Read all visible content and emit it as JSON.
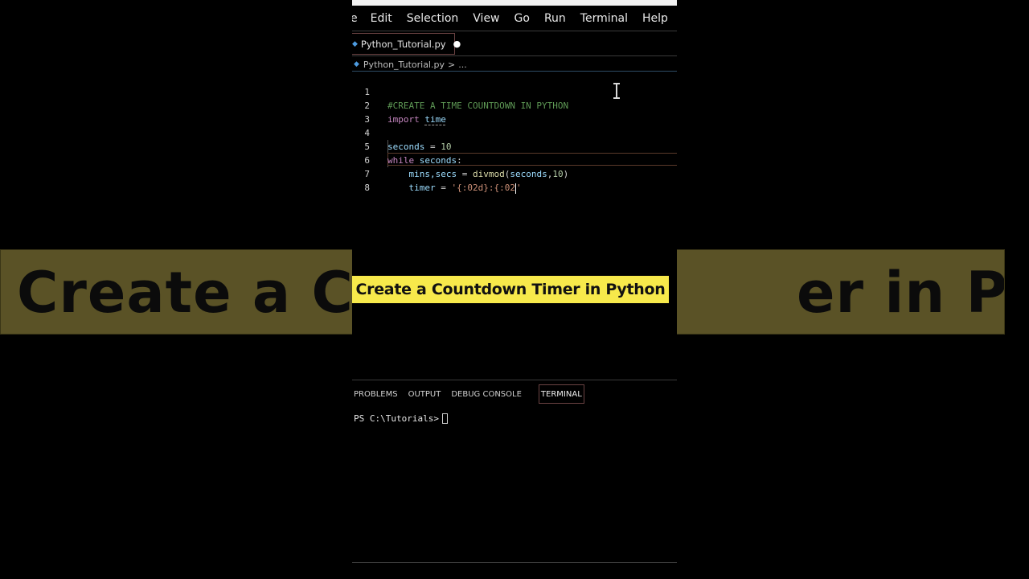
{
  "background": {
    "banner_left_text": "Create a Cou",
    "banner_right_text": "er in Python"
  },
  "menubar": {
    "items": [
      "e",
      "Edit",
      "Selection",
      "View",
      "Go",
      "Run",
      "Terminal",
      "Help"
    ]
  },
  "tab": {
    "filename": "Python_Tutorial.py",
    "modified_dot": "●"
  },
  "breadcrumb": {
    "file": "Python_Tutorial.py",
    "separator": ">",
    "rest": "..."
  },
  "code": {
    "line_numbers": [
      "1",
      "2",
      "3",
      "4",
      "5",
      "6",
      "7",
      "8"
    ],
    "l1": "#CREATE A TIME COUNTDOWN IN PYTHON",
    "l2_kw": "import",
    "l2_mod": "time",
    "l4_var": "seconds",
    "l4_eq": " = ",
    "l4_num": "10",
    "l5_kw": "while",
    "l5_var": "seconds",
    "l5_colon": ":",
    "l6_vars": "mins,secs",
    "l6_eq": " = ",
    "l6_fn": "divmod",
    "l6_open": "(",
    "l6_arg": "seconds",
    "l6_comma": ",",
    "l6_num": "10",
    "l6_close": ")",
    "l7_var": "timer",
    "l7_eq": " = ",
    "l7_str_a": "'{:02d}:{:02",
    "l7_str_b": "'"
  },
  "title": {
    "text": "Create a Countdown Timer in Python"
  },
  "panel": {
    "tabs": [
      "PROBLEMS",
      "OUTPUT",
      "DEBUG CONSOLE",
      "TERMINAL"
    ],
    "active_tab": "TERMINAL",
    "prompt": "PS C:\\Tutorials>"
  },
  "colors": {
    "title_bg": "#f7e94b",
    "comment": "#5e9955",
    "keyword": "#c586c0",
    "variable": "#9cdcfe",
    "string": "#ce9178",
    "number": "#b5cea8",
    "function": "#dcdcaa"
  }
}
